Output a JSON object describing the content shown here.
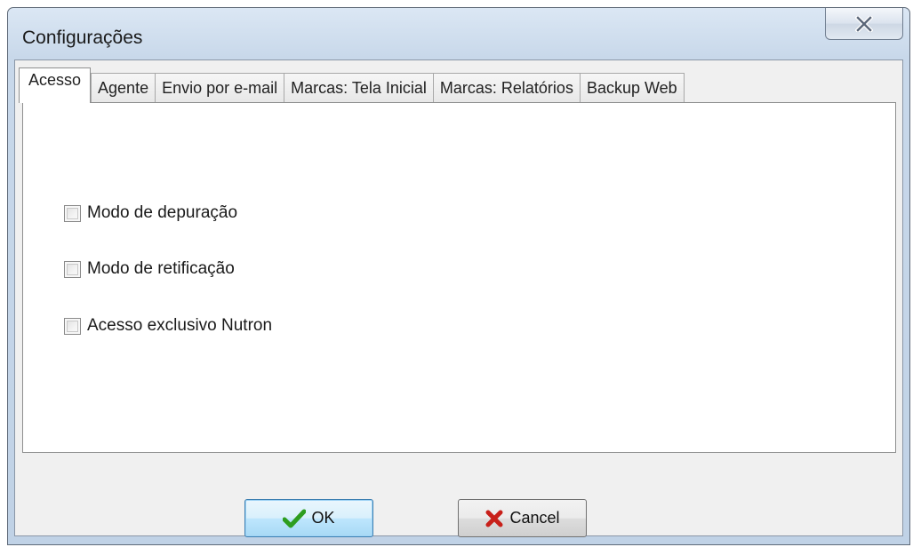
{
  "window": {
    "title": "Configurações",
    "close_icon": "close-icon"
  },
  "tabs": [
    {
      "label": "Acesso",
      "active": true
    },
    {
      "label": "Agente",
      "active": false
    },
    {
      "label": "Envio por e-mail",
      "active": false
    },
    {
      "label": "Marcas: Tela Inicial",
      "active": false
    },
    {
      "label": "Marcas: Relatórios",
      "active": false
    },
    {
      "label": "Backup Web",
      "active": false
    }
  ],
  "options": [
    {
      "label": "Modo de depuração",
      "checked": false
    },
    {
      "label": "Modo de retificação",
      "checked": false
    },
    {
      "label": "Acesso exclusivo Nutron",
      "checked": false
    }
  ],
  "buttons": {
    "ok": {
      "label": "OK",
      "icon": "check-icon"
    },
    "cancel": {
      "label": "Cancel",
      "icon": "x-icon"
    }
  },
  "colors": {
    "check_green": "#2e9d1f",
    "cancel_red": "#c8201a"
  }
}
